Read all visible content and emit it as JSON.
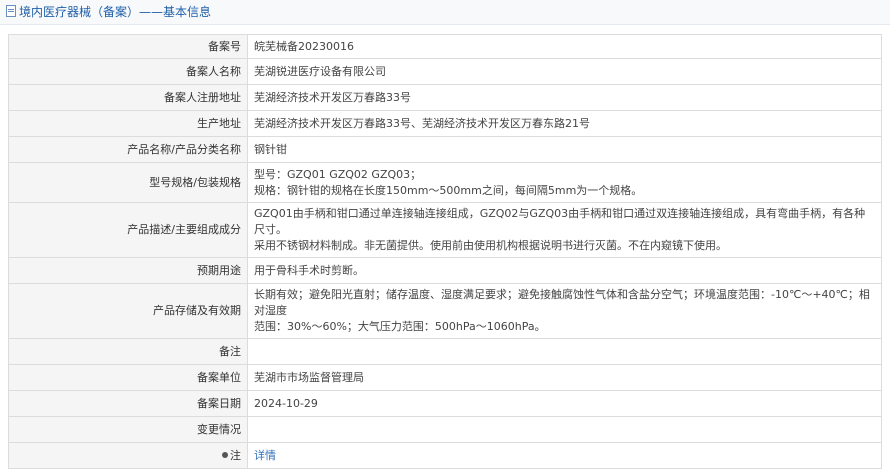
{
  "header": {
    "title": "境内医疗器械（备案）",
    "separator": "——",
    "subtitle": "基本信息",
    "icon": "document-icon"
  },
  "rows": [
    {
      "label": "备案号",
      "value": [
        "皖芜械备20230016"
      ]
    },
    {
      "label": "备案人名称",
      "value": [
        "芜湖锐进医疗设备有限公司"
      ]
    },
    {
      "label": "备案人注册地址",
      "value": [
        "芜湖经济技术开发区万春路33号"
      ]
    },
    {
      "label": "生产地址",
      "value": [
        "芜湖经济技术开发区万春路33号、芜湖经济技术开发区万春东路21号"
      ]
    },
    {
      "label": "产品名称/产品分类名称",
      "value": [
        "钢针钳"
      ]
    },
    {
      "label": "型号规格/包装规格",
      "value": [
        "型号：GZQ01 GZQ02 GZQ03；",
        "规格：钢针钳的规格在长度150mm～500mm之间，每间隔5mm为一个规格。"
      ]
    },
    {
      "label": "产品描述/主要组成成分",
      "value": [
        "GZQ01由手柄和钳口通过单连接轴连接组成，GZQ02与GZQ03由手柄和钳口通过双连接轴连接组成，具有弯曲手柄，有各种尺寸。",
        "采用不锈钢材料制成。非无菌提供。使用前由使用机构根据说明书进行灭菌。不在内窥镜下使用。"
      ]
    },
    {
      "label": "预期用途",
      "value": [
        "用于骨科手术时剪断。"
      ]
    },
    {
      "label": "产品存储及有效期",
      "value": [
        "长期有效；避免阳光直射；储存温度、湿度满足要求；避免接触腐蚀性气体和含盐分空气；环境温度范围：-10℃～+40℃；相对湿度",
        "范围：30%～60%；大气压力范围：500hPa～1060hPa。"
      ]
    },
    {
      "label": "备注",
      "value": [
        ""
      ]
    },
    {
      "label": "备案单位",
      "value": [
        "芜湖市市场监督管理局"
      ]
    },
    {
      "label": "备案日期",
      "value": [
        "2024-10-29"
      ]
    },
    {
      "label": "变更情况",
      "value": [
        ""
      ]
    }
  ],
  "note_row": {
    "label": "注",
    "icon": "bulb-icon",
    "link_text": "详情"
  }
}
